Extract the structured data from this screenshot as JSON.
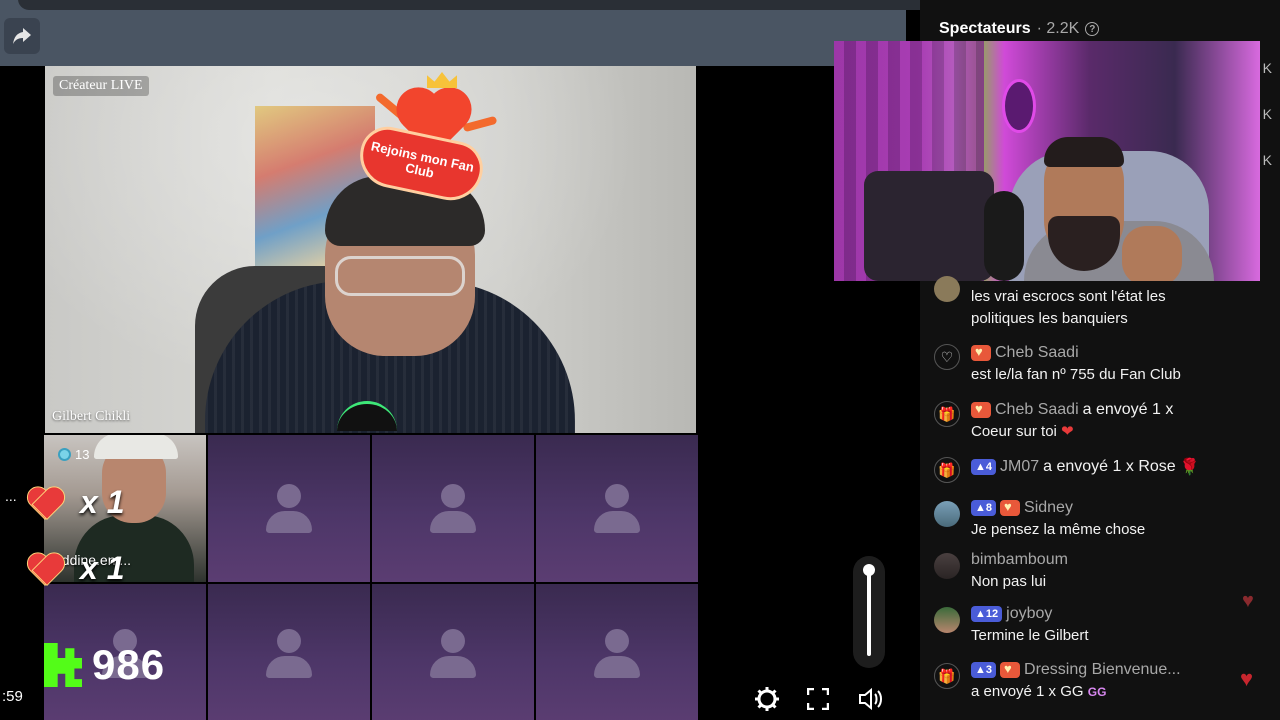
{
  "host": {
    "creator_label": "Créateur LIVE",
    "name": "Gilbert Chikli",
    "sticker_text": "Rejoins mon Fan Club"
  },
  "guest": {
    "level": "13",
    "name": "eddine.en...."
  },
  "combos": [
    {
      "count": "x 1"
    },
    {
      "count": "x 1"
    }
  ],
  "kick_count": "986",
  "left_time": ":59",
  "left_dots": "...",
  "viewers": {
    "title": "Spectateurs",
    "count": "· 2.2K",
    "help": "?"
  },
  "side_values": [
    "K",
    "K",
    "K"
  ],
  "chat": [
    {
      "text": "les vrai escrocs sont l'état les politiques les banquiers"
    },
    {
      "user": "Cheb Saadi",
      "text": "est le/la fan nº 755 du Fan Club"
    },
    {
      "user": "Cheb Saadi",
      "head_suffix": "a envoyé 1 x",
      "text": "Coeur sur toi"
    },
    {
      "level": "4",
      "user": "JM07",
      "head_suffix": "a envoyé 1 x Rose"
    },
    {
      "level": "8",
      "user": "Sidney",
      "text": "Je pensez la même chose"
    },
    {
      "user": "bimbamboum",
      "text": "Non pas lui"
    },
    {
      "level": "12",
      "user": "joyboy",
      "text": "Termine le Gilbert"
    },
    {
      "level": "3",
      "user": "Dressing Bienvenue...",
      "text": "a envoyé 1 x GG"
    }
  ],
  "colors": {
    "kick_green": "#53fc18",
    "tile_purple": "#4d3668",
    "level_blue": "#4a5cd8",
    "panel_bg": "#111111"
  }
}
